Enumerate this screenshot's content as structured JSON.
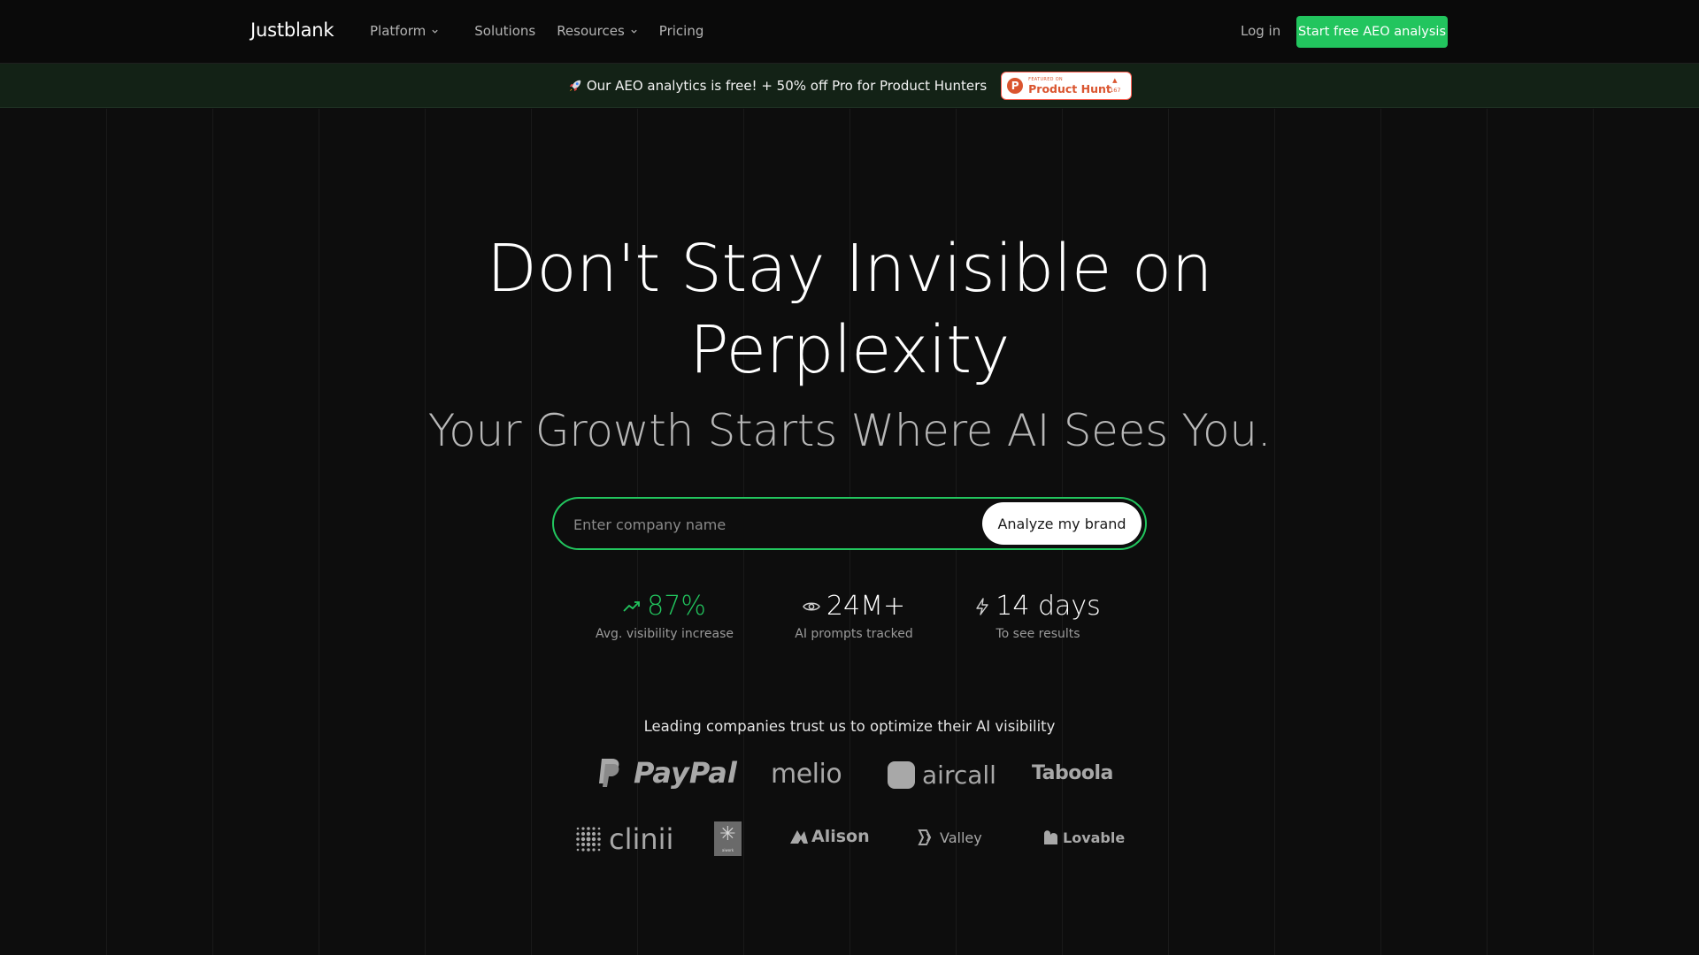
{
  "header": {
    "logo": "Justblank",
    "nav": [
      {
        "label": "Platform",
        "has_dropdown": true
      },
      {
        "label": "Solutions",
        "has_dropdown": false
      },
      {
        "label": "Resources",
        "has_dropdown": true
      },
      {
        "label": "Pricing",
        "has_dropdown": false
      }
    ],
    "login": "Log in",
    "cta": "Start free AEO analysis"
  },
  "banner": {
    "icon": "rocket-icon",
    "text": "Our AEO analytics is free! + 50% off Pro for Product Hunters",
    "badge": {
      "featured": "FEATURED ON",
      "name": "Product Hunt",
      "count": "167"
    }
  },
  "hero": {
    "title_line1": "Don't Stay Invisible on",
    "title_line2": "Perplexity",
    "subtitle": "Your Growth Starts Where AI Sees You."
  },
  "search": {
    "placeholder": "Enter company name",
    "value": "",
    "button": "Analyze my brand"
  },
  "stats": [
    {
      "icon": "trending-up-icon",
      "value": "87%",
      "label": "Avg. visibility increase",
      "color": "#22c55e"
    },
    {
      "icon": "eye-icon",
      "value": "24M+",
      "label": "AI prompts tracked",
      "color": "#ffffff"
    },
    {
      "icon": "lightning-icon",
      "value": "14 days",
      "label": "To see results",
      "color": "#ffffff"
    }
  ],
  "trust": {
    "text": "Leading companies trust us to optimize their AI visibility",
    "logos": [
      "PayPal",
      "melio",
      "aircall",
      "Taboola",
      "clinii",
      "aiwork",
      "Alison",
      "Valley",
      "Lovable"
    ]
  },
  "colors": {
    "accent": "#22c55e",
    "background": "#0d0d0d",
    "banner": "#132216"
  }
}
